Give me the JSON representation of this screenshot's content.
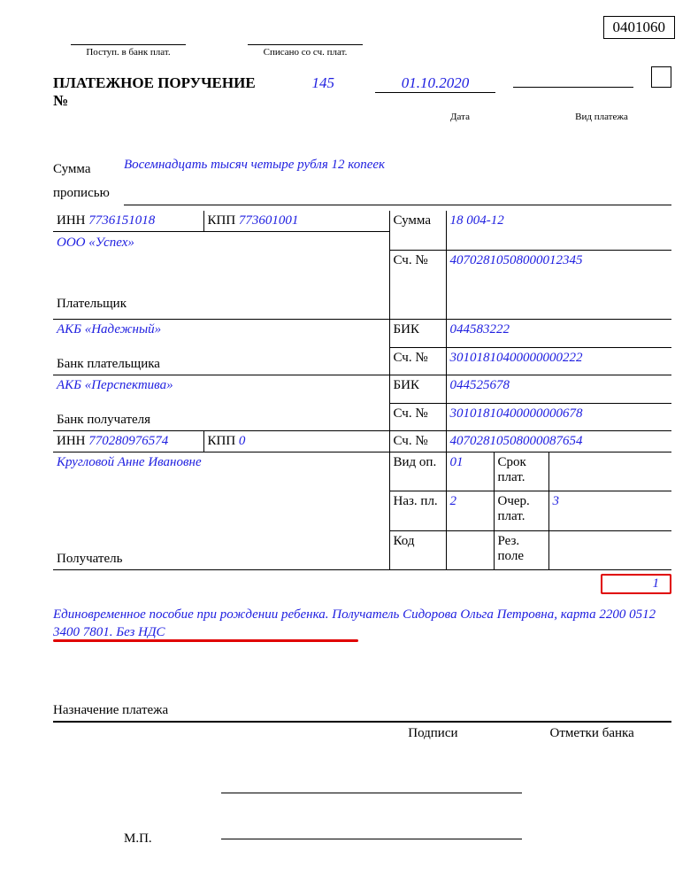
{
  "form_code": "0401060",
  "top": {
    "received": "Поступ. в банк плат.",
    "writtenoff": "Списано со сч. плат."
  },
  "title": {
    "text": "ПЛАТЕЖНОЕ ПОРУЧЕНИЕ №",
    "number": "145",
    "date": "01.10.2020",
    "date_label": "Дата",
    "type_label": "Вид платежа"
  },
  "amount_words": {
    "label1": "Сумма",
    "label2": "прописью",
    "text": "Восемнадцать тысяч четыре рубля 12 копеек"
  },
  "payer": {
    "inn_label": "ИНН",
    "inn": "7736151018",
    "kpp_label": "КПП",
    "kpp": "773601001",
    "name": "ООО «Успех»",
    "label": "Плательщик",
    "amount_label": "Сумма",
    "amount": "18 004-12",
    "acc_label": "Сч. №",
    "acc": "40702810508000012345"
  },
  "payer_bank": {
    "name": "АКБ «Надежный»",
    "label": "Банк плательщика",
    "bik_label": "БИК",
    "bik": "044583222",
    "acc_label": "Сч. №",
    "acc": "30101810400000000222"
  },
  "recip_bank": {
    "name": "АКБ «Перспектива»",
    "label": "Банк получателя",
    "bik_label": "БИК",
    "bik": "044525678",
    "acc_label": "Сч. №",
    "acc": "30101810400000000678"
  },
  "recip": {
    "inn_label": "ИНН",
    "inn": "770280976574",
    "kpp_label": "КПП",
    "kpp": "0",
    "name": "Кругловой Анне Ивановне",
    "label": "Получатель",
    "acc_label": "Сч. №",
    "acc": "40702810508000087654"
  },
  "ops": {
    "vid_op_label": "Вид оп.",
    "vid_op": "01",
    "srok_label": "Срок плат.",
    "naz_label": "Наз. пл.",
    "naz": "2",
    "ocher_label": "Очер. плат.",
    "ocher": "3",
    "kod_label": "Код",
    "rez_label": "Рез. поле"
  },
  "small_box": "1",
  "purpose_text": "Единовременное пособие при рождении ребенка. Получатель Сидорова Ольга Петровна, карта 2200 0512 3400 7801. Без НДС",
  "purpose_label": "Назначение платежа",
  "signatures": {
    "sign": "Подписи",
    "bank_marks": "Отметки банка",
    "mp": "М.П."
  }
}
